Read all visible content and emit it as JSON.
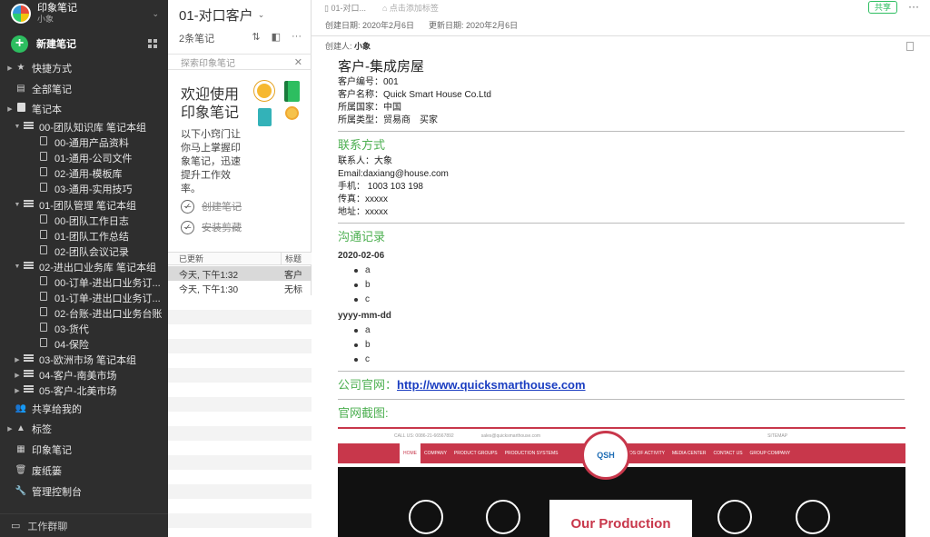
{
  "sidebar": {
    "account_name": "印象笔记",
    "account_user": "小象",
    "new_note": "新建笔记",
    "items": [
      {
        "label": "快捷方式",
        "icon": "star-icon"
      },
      {
        "label": "全部笔记",
        "icon": "notes-icon"
      },
      {
        "label": "笔记本",
        "icon": "notebook-icon"
      },
      {
        "label": "00-团队知识库 笔记本组",
        "icon": "stack-icon"
      },
      {
        "label": "00-通用产品资料",
        "icon": "note-icon"
      },
      {
        "label": "01-通用-公司文件",
        "icon": "note-icon"
      },
      {
        "label": "02-通用-模板库",
        "icon": "note-icon"
      },
      {
        "label": "03-通用-实用技巧",
        "icon": "note-icon"
      },
      {
        "label": "01-团队管理 笔记本组",
        "icon": "stack-icon"
      },
      {
        "label": "00-团队工作日志",
        "icon": "note-icon"
      },
      {
        "label": "01-团队工作总结",
        "icon": "note-icon"
      },
      {
        "label": "02-团队会议记录",
        "icon": "note-icon"
      },
      {
        "label": "02-进出口业务库 笔记本组",
        "icon": "stack-icon"
      },
      {
        "label": "00-订单-进出口业务订...",
        "icon": "note-icon"
      },
      {
        "label": "01-订单-进出口业务订...",
        "icon": "note-icon"
      },
      {
        "label": "02-台账-进出口业务台账",
        "icon": "note-icon"
      },
      {
        "label": "03-货代",
        "icon": "note-icon"
      },
      {
        "label": "04-保险",
        "icon": "note-icon"
      },
      {
        "label": "03-欧洲市场 笔记本组",
        "icon": "stack-icon"
      },
      {
        "label": "04-客户-南美市场",
        "icon": "stack-icon"
      },
      {
        "label": "05-客户-北美市场",
        "icon": "stack-icon"
      },
      {
        "label": "共享给我的",
        "icon": "people-icon"
      },
      {
        "label": "标签",
        "icon": "tag-icon"
      },
      {
        "label": "印象笔记",
        "icon": "building-icon"
      },
      {
        "label": "废纸篓",
        "icon": "trash-icon"
      },
      {
        "label": "管理控制台",
        "icon": "wrench-icon"
      }
    ],
    "footer": "工作群聊"
  },
  "list": {
    "title": "01-对口客户",
    "count": "2条笔记",
    "search_placeholder": "探索印象笔记",
    "welcome_title": "欢迎使用印象笔记",
    "welcome_desc": "以下小窍门让你马上掌握印象笔记，迅速提升工作效率。",
    "task1": "创建笔记",
    "task2": "安装剪藏",
    "col_updated": "已更新",
    "col_title": "标题",
    "rows": [
      {
        "updated": "今天, 下午1:32",
        "title": "客户"
      },
      {
        "updated": "今天, 下午1:30",
        "title": "无标"
      }
    ]
  },
  "editor": {
    "notebook": "01-对口...",
    "add_tag": "点击添加标签",
    "share": "共享",
    "more": "···",
    "created": "创建日期: 2020年2月6日",
    "updated": "更新日期: 2020年2月6日",
    "author_label": "创建人:",
    "author": "小象",
    "title": "客户-集成房屋",
    "info": [
      "客户编号：001",
      "客户名称：Quick Smart House Co.Ltd",
      "所属国家：中国",
      "所属类型：贸易商　买家"
    ],
    "contact_heading": "联系方式",
    "contact": [
      "联系人：大象",
      "Email:daxiang@house.com",
      "手机： 1003 103 198",
      "传真：xxxxx",
      "地址：xxxxx"
    ],
    "comm_heading": "沟通记录",
    "entries": [
      {
        "date": "2020-02-06",
        "items": [
          "a",
          "b",
          "c"
        ]
      },
      {
        "date": "yyyy-mm-dd",
        "items": [
          "a",
          "b",
          "c"
        ]
      }
    ],
    "site_label": "公司官网：",
    "site_url": "http://www.quicksmarthouse.com",
    "shot_heading": "官网截图:",
    "shot": {
      "top_left": "CALL US: 0086-21-66567892",
      "top_mid": "sales@quicksmarthouse.com",
      "sitemap": "SITEMAP",
      "nav": [
        "HOME",
        "COMPANY",
        "PRODUCT GROUPS",
        "PRODUCTION SYSTEMS",
        "FIELDS OF ACTIVITY",
        "MEDIA CENTER",
        "CONTACT US",
        "GROUP COMPANY"
      ],
      "logo": "QSH",
      "hero_text": "Our Production"
    }
  }
}
